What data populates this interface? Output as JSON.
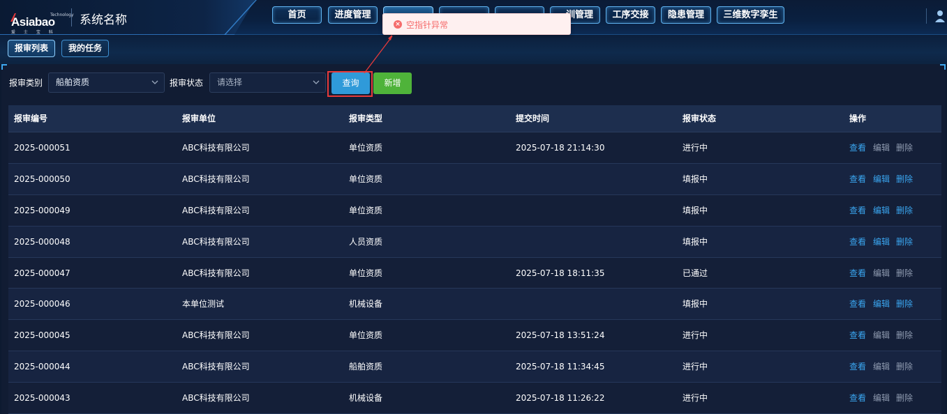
{
  "header": {
    "logo_small": "Technology",
    "logo_main": "Asiabao",
    "logo_sub": "爱 士 宝 科 技",
    "system_name": "系统名称",
    "nav": [
      {
        "label": "首页"
      },
      {
        "label": "进度管理"
      },
      {
        "label": "…"
      },
      {
        "label": "…"
      },
      {
        "label": "…"
      },
      {
        "label": "…训管理"
      },
      {
        "label": "工序交接"
      },
      {
        "label": "隐患管理"
      },
      {
        "label": "三维数字孪生"
      }
    ]
  },
  "subtabs": [
    {
      "label": "报审列表",
      "active": true
    },
    {
      "label": "我的任务",
      "active": false
    }
  ],
  "filters": {
    "category_label": "报审类别",
    "category_value": "船舶资质",
    "status_label": "报审状态",
    "status_placeholder": "请选择",
    "query_button": "查询",
    "add_button": "新增"
  },
  "table": {
    "columns": [
      "报审编号",
      "报审单位",
      "报审类型",
      "提交时间",
      "报审状态",
      "操作"
    ],
    "actions": {
      "view": "查看",
      "edit": "编辑",
      "delete": "删除"
    },
    "rows": [
      {
        "id": "2025-000051",
        "unit": "ABC科技有限公司",
        "type": "单位资质",
        "time": "2025-07-18 21:14:30",
        "status": "进行中",
        "edit_enabled": false,
        "delete_enabled": false
      },
      {
        "id": "2025-000050",
        "unit": "ABC科技有限公司",
        "type": "单位资质",
        "time": "",
        "status": "填报中",
        "edit_enabled": true,
        "delete_enabled": true
      },
      {
        "id": "2025-000049",
        "unit": "ABC科技有限公司",
        "type": "单位资质",
        "time": "",
        "status": "填报中",
        "edit_enabled": true,
        "delete_enabled": true
      },
      {
        "id": "2025-000048",
        "unit": "ABC科技有限公司",
        "type": "人员资质",
        "time": "",
        "status": "填报中",
        "edit_enabled": true,
        "delete_enabled": true
      },
      {
        "id": "2025-000047",
        "unit": "ABC科技有限公司",
        "type": "单位资质",
        "time": "2025-07-18 18:11:35",
        "status": "已通过",
        "edit_enabled": false,
        "delete_enabled": false
      },
      {
        "id": "2025-000046",
        "unit": "本单位测试",
        "type": "机械设备",
        "time": "",
        "status": "填报中",
        "edit_enabled": true,
        "delete_enabled": true
      },
      {
        "id": "2025-000045",
        "unit": "ABC科技有限公司",
        "type": "单位资质",
        "time": "2025-07-18 13:51:24",
        "status": "进行中",
        "edit_enabled": false,
        "delete_enabled": false
      },
      {
        "id": "2025-000044",
        "unit": "ABC科技有限公司",
        "type": "船舶资质",
        "time": "2025-07-18 11:34:45",
        "status": "进行中",
        "edit_enabled": false,
        "delete_enabled": false
      },
      {
        "id": "2025-000043",
        "unit": "ABC科技有限公司",
        "type": "机械设备",
        "time": "2025-07-18 11:26:22",
        "status": "进行中",
        "edit_enabled": false,
        "delete_enabled": false
      }
    ]
  },
  "toast": {
    "type": "error",
    "icon": "close-circle-icon",
    "message": "空指针异常"
  },
  "colors": {
    "accent": "#2f9ad9",
    "add": "#4fb33a",
    "link": "#3aa6f0",
    "error": "#f56c6c",
    "highlight": "#e83a3a"
  }
}
